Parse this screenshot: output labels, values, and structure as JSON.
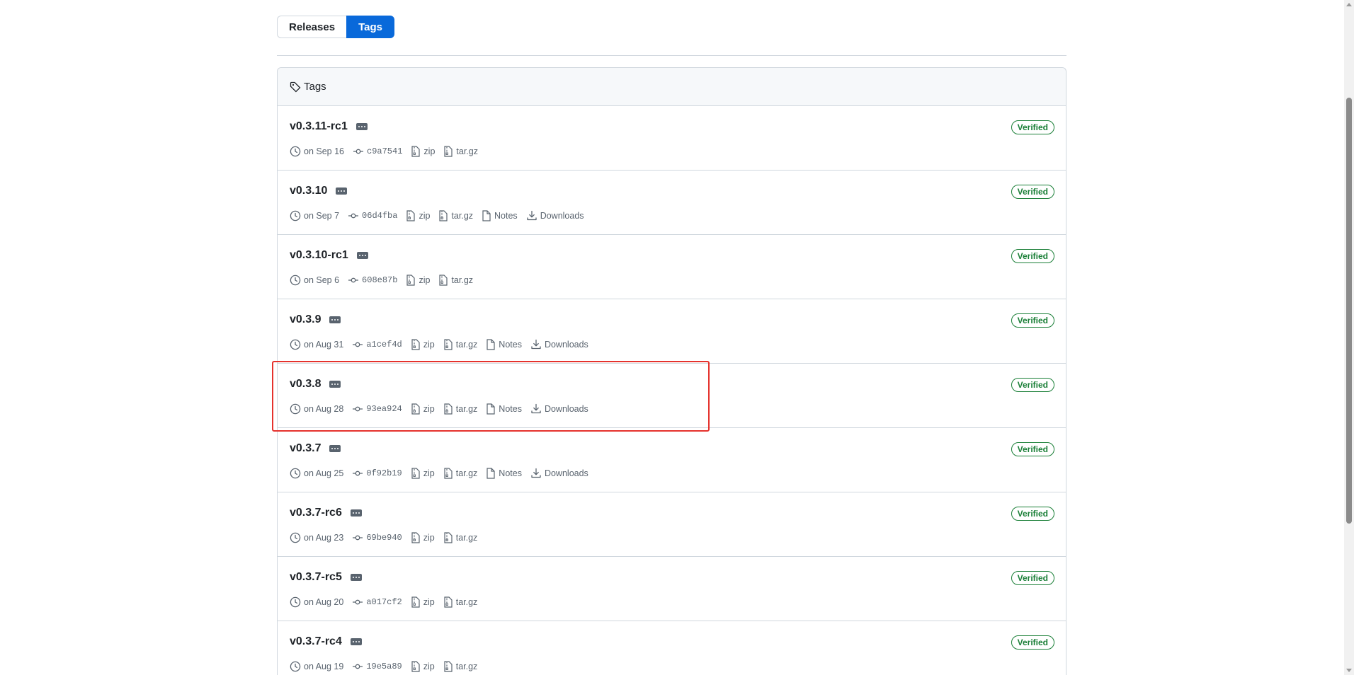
{
  "segmented": {
    "releases_label": "Releases",
    "tags_label": "Tags"
  },
  "header": {
    "title": "Tags"
  },
  "tags": [
    {
      "name": "v0.3.11-rc1",
      "date": "on Sep 16",
      "commit": "c9a7541",
      "zip": "zip",
      "targz": "tar.gz",
      "notes": "",
      "downloads": "",
      "badge": "Verified"
    },
    {
      "name": "v0.3.10",
      "date": "on Sep 7",
      "commit": "06d4fba",
      "zip": "zip",
      "targz": "tar.gz",
      "notes": "Notes",
      "downloads": "Downloads",
      "badge": "Verified"
    },
    {
      "name": "v0.3.10-rc1",
      "date": "on Sep 6",
      "commit": "608e87b",
      "zip": "zip",
      "targz": "tar.gz",
      "notes": "",
      "downloads": "",
      "badge": "Verified"
    },
    {
      "name": "v0.3.9",
      "date": "on Aug 31",
      "commit": "a1cef4d",
      "zip": "zip",
      "targz": "tar.gz",
      "notes": "Notes",
      "downloads": "Downloads",
      "badge": "Verified"
    },
    {
      "name": "v0.3.8",
      "date": "on Aug 28",
      "commit": "93ea924",
      "zip": "zip",
      "targz": "tar.gz",
      "notes": "Notes",
      "downloads": "Downloads",
      "badge": "Verified"
    },
    {
      "name": "v0.3.7",
      "date": "on Aug 25",
      "commit": "0f92b19",
      "zip": "zip",
      "targz": "tar.gz",
      "notes": "Notes",
      "downloads": "Downloads",
      "badge": "Verified"
    },
    {
      "name": "v0.3.7-rc6",
      "date": "on Aug 23",
      "commit": "69be940",
      "zip": "zip",
      "targz": "tar.gz",
      "notes": "",
      "downloads": "",
      "badge": "Verified"
    },
    {
      "name": "v0.3.7-rc5",
      "date": "on Aug 20",
      "commit": "a017cf2",
      "zip": "zip",
      "targz": "tar.gz",
      "notes": "",
      "downloads": "",
      "badge": "Verified"
    },
    {
      "name": "v0.3.7-rc4",
      "date": "on Aug 19",
      "commit": "19e5a89",
      "zip": "zip",
      "targz": "tar.gz",
      "notes": "",
      "downloads": "",
      "badge": "Verified"
    }
  ],
  "colors": {
    "accent": "#0969da",
    "verified": "#1a7f37",
    "highlight": "#e5322d"
  },
  "icons": {
    "header": "tag-icon",
    "date": "clock-icon",
    "commit": "git-commit-icon",
    "archive": "file-zip-icon",
    "notes": "file-icon",
    "downloads": "download-icon",
    "more": "kebab-horizontal-icon"
  }
}
